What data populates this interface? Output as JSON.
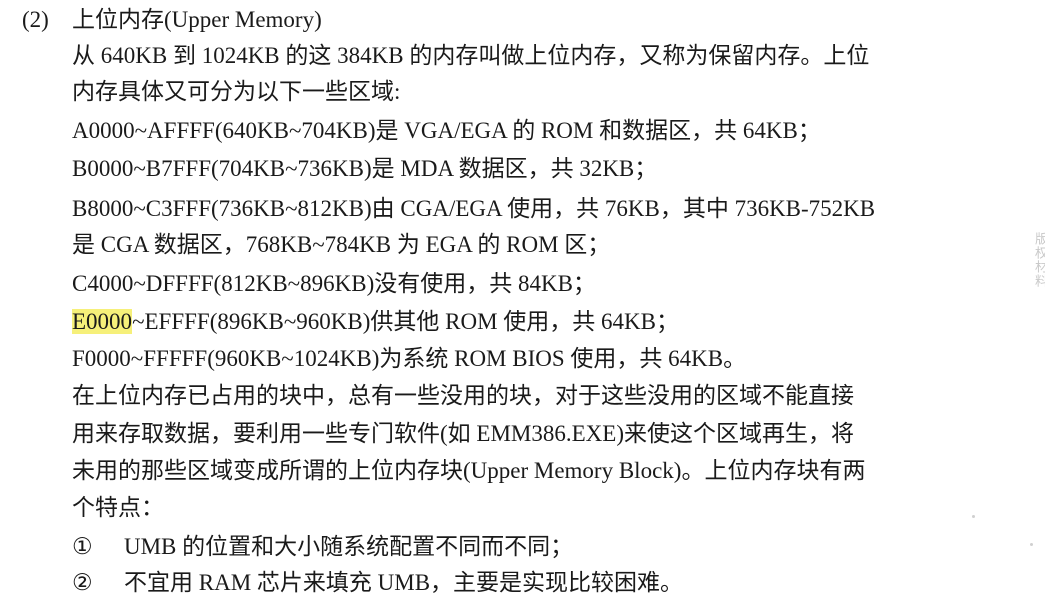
{
  "heading": {
    "number": "(2)",
    "title": "上位内存(Upper Memory)"
  },
  "intro": [
    "从 640KB 到 1024KB 的这 384KB 的内存叫做上位内存，又称为保留内存。上位",
    "内存具体又可分为以下一些区域:"
  ],
  "regions": [
    "A0000~AFFFF(640KB~704KB)是 VGA/EGA 的 ROM 和数据区，共 64KB；",
    "B0000~B7FFF(704KB~736KB)是 MDA 数据区，共 32KB；",
    "B8000~C3FFF(736KB~812KB)由 CGA/EGA 使用，共 76KB，其中 736KB-752KB",
    "是 CGA 数据区，768KB~784KB 为 EGA 的 ROM 区；",
    "C4000~DFFFF(812KB~896KB)没有使用，共 84KB；"
  ],
  "highlighted_region": {
    "highlight": "E0000",
    "rest": "~EFFFF(896KB~960KB)供其他 ROM 使用，共 64KB；"
  },
  "last_region": "F0000~FFFFF(960KB~1024KB)为系统 ROM BIOS 使用，共 64KB。",
  "paragraph": [
    "在上位内存已占用的块中，总有一些没用的块，对于这些没用的区域不能直接",
    "用来存取数据，要利用一些专门软件(如 EMM386.EXE)来使这个区域再生，将",
    "未用的那些区域变成所谓的上位内存块(Upper Memory Block)。上位内存块有两",
    "个特点："
  ],
  "features": [
    {
      "marker": "①",
      "text": "UMB 的位置和大小随系统配置不同而不同；"
    },
    {
      "marker": "②",
      "text": "不宜用 RAM 芯片来填充 UMB，主要是实现比较困难。"
    }
  ],
  "watermark": "版权材料",
  "colors": {
    "highlight": "#f6f07a",
    "text": "#1a1a1a",
    "watermark": "#c9c9c9"
  }
}
